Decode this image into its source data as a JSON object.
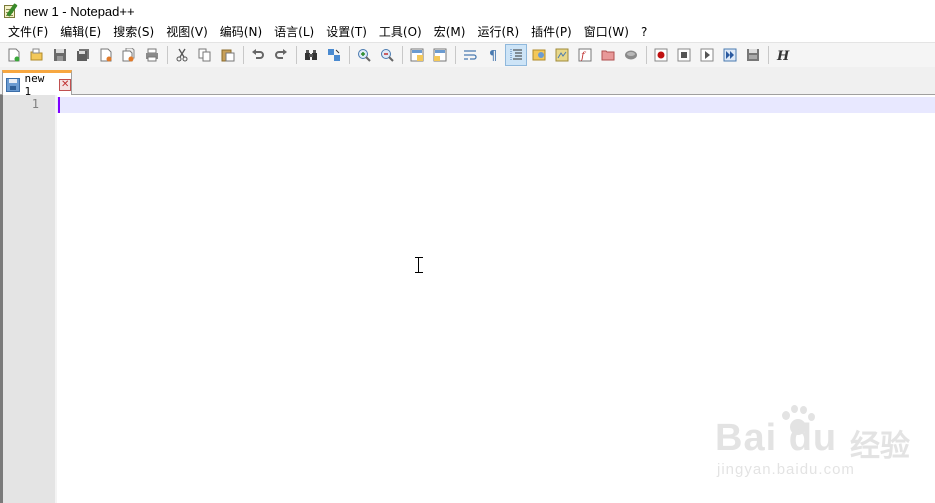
{
  "window": {
    "title": "new 1 - Notepad++"
  },
  "menu": {
    "items": [
      {
        "label": "文件(F)"
      },
      {
        "label": "编辑(E)"
      },
      {
        "label": "搜索(S)"
      },
      {
        "label": "视图(V)"
      },
      {
        "label": "编码(N)"
      },
      {
        "label": "语言(L)"
      },
      {
        "label": "设置(T)"
      },
      {
        "label": "工具(O)"
      },
      {
        "label": "宏(M)"
      },
      {
        "label": "运行(R)"
      },
      {
        "label": "插件(P)"
      },
      {
        "label": "窗口(W)"
      },
      {
        "label": "?"
      }
    ]
  },
  "toolbar": {
    "icons": [
      "new-file-icon",
      "open-file-icon",
      "save-icon",
      "save-all-icon",
      "close-icon",
      "close-all-icon",
      "print-icon",
      "cut-icon",
      "copy-icon",
      "paste-icon",
      "undo-icon",
      "redo-icon",
      "find-icon",
      "replace-icon",
      "zoom-in-icon",
      "zoom-out-icon",
      "sync-vertical-icon",
      "sync-horizontal-icon",
      "word-wrap-icon",
      "show-all-chars-icon",
      "indent-guide-icon",
      "user-defined-language-icon",
      "document-map-icon",
      "function-list-icon",
      "folder-as-workspace-icon",
      "monitoring-icon",
      "record-macro-icon",
      "stop-record-icon",
      "play-macro-icon",
      "run-macro-multiple-icon",
      "save-macro-icon",
      "hex-icon"
    ],
    "hex_glyph": "H"
  },
  "tabs": [
    {
      "label": "new 1",
      "close_glyph": "✕"
    }
  ],
  "editor": {
    "line_numbers": [
      "1"
    ],
    "lines": [
      ""
    ]
  },
  "watermark": {
    "logo": "Bai du",
    "cn": "经验",
    "url": "jingyan.baidu.com"
  },
  "colors": {
    "tab_accent": "#f7a740",
    "current_line": "#e8e8ff",
    "caret": "#8000ff",
    "gutter": "#e4e4e4"
  }
}
